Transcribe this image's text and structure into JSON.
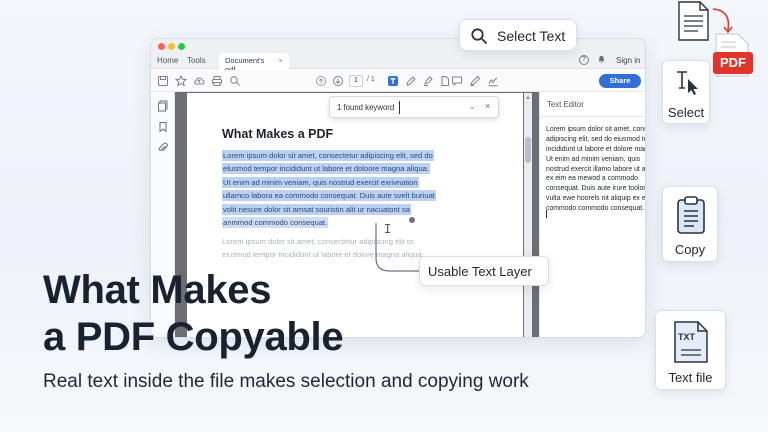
{
  "window": {
    "menu": {
      "home": "Home",
      "tools": "Tools"
    },
    "tab": {
      "title": "Document's pdf...",
      "close": "×"
    },
    "signin": "Sign in",
    "help": "?",
    "toolbar": {
      "page_current": "1",
      "page_total": "/ 1",
      "share_label": "Share"
    },
    "search": {
      "value": "1 found keyword",
      "chevron": "⌄",
      "close": "×"
    },
    "document": {
      "heading": "What Makes a PDF",
      "selected_lines": [
        "Lorem ipsum dolor sit amet, consectetur adipiscing elit, sed do",
        "elusmod tempor incididunt ut labore et doloore magna aliqua.",
        "Ut enim ad minim veniam, quis nostrud exercit exrivnation",
        "ullamco labora ea commodo consequat. Duis aute svelt buriuat",
        "volit nesure dolor sit amsat souristin alit ur nacuatont sa",
        "anmmod commodo consequat."
      ],
      "faded_lines": [
        "Lorem ipsum dolor sit amet, consectetur adipiscing elit to",
        "eiusmod tempor incididunt ut labore et dolore magna aliqua."
      ]
    },
    "editor": {
      "title": "Text Editor",
      "lines": [
        "Lorem ipsum dolor sit amet, consectetur",
        "adipiscing elit, sed do eiusmod tempor",
        "incididunt ut labore et dolore magna aliq,",
        "Ut enim ad minim veniam, quis",
        "nostrud exercit illamo labore ut aliquip.",
        "ex eim ea mewod a commodo",
        "consequat. Duis aute irure toolor fit in",
        "vulta ewe hoorels nit aliquip ex ea",
        "commodo commodo consequat."
      ]
    }
  },
  "callouts": {
    "select_text": "Select Text",
    "usable_text_layer": "Usable Text Layer"
  },
  "cards": {
    "select": "Select",
    "copy": "Copy",
    "text_file": "Text file",
    "pdf_badge": "PDF",
    "txt_badge": "TXT"
  },
  "headline": {
    "line1": "What Makes",
    "line2": "a PDF Copyable",
    "subtitle": "Real text inside the file makes selection and copying work"
  },
  "colors": {
    "accent_blue": "#2f6fd6",
    "selection": "#bcd0ef",
    "pdf_red": "#e0352b",
    "doc_gray": "#6b6f75"
  }
}
